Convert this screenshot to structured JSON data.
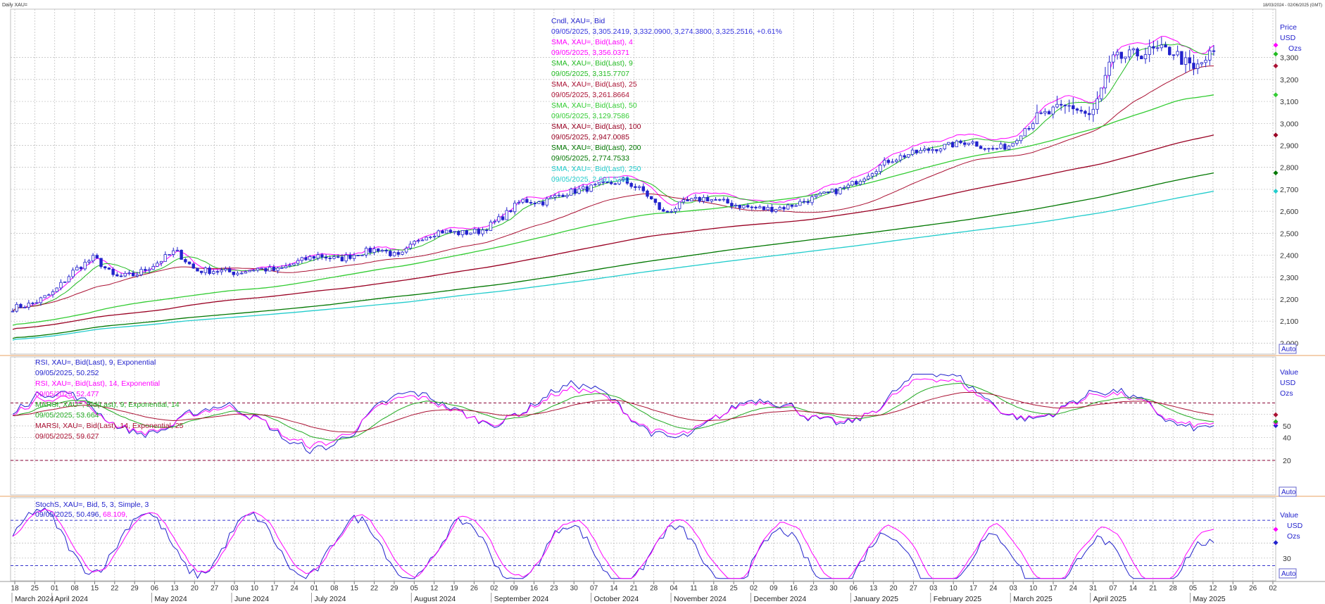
{
  "window": {
    "title": "Daily XAU=",
    "date_range": "18/03/2024 - 02/06/2025 (GMT)"
  },
  "price_panel": {
    "legend": [
      {
        "title": "Cndl, XAU=, Bid",
        "value": "09/05/2025, 3,305.2419, 3,332.0900, 3,274.3800, 3,325.2516, +0.61%",
        "color": "#2222cc",
        "value_color": "#3333dd"
      },
      {
        "title": "SMA, XAU=, Bid(Last),  4",
        "value": "09/05/2025, 3,356.0371",
        "color": "#ff00ff",
        "value_color": "#ff00ff"
      },
      {
        "title": "SMA, XAU=, Bid(Last),  9",
        "value": "09/05/2025, 3,315.7707",
        "color": "#22bb22",
        "value_color": "#22bb22"
      },
      {
        "title": "SMA, XAU=, Bid(Last),  25",
        "value": "09/05/2025, 3,261.8664",
        "color": "#aa1133",
        "value_color": "#aa1133"
      },
      {
        "title": "SMA, XAU=, Bid(Last),  50",
        "value": "09/05/2025, 3,129.7586",
        "color": "#33cc33",
        "value_color": "#33cc33"
      },
      {
        "title": "SMA, XAU=, Bid(Last),  100",
        "value": "09/05/2025, 2,947.0085",
        "color": "#990022",
        "value_color": "#990022"
      },
      {
        "title": "SMA, XAU=, Bid(Last),  200",
        "value": "09/05/2025, 2,774.7533",
        "color": "#007700",
        "value_color": "#007700"
      },
      {
        "title": "SMA, XAU=, Bid(Last),  250",
        "value": "09/05/2025, 2,691.5230",
        "color": "#22cccc",
        "value_color": "#22cccc"
      }
    ],
    "axis_header": [
      "Price",
      "USD",
      "Ozs"
    ],
    "auto_label": "Auto"
  },
  "rsi_panel": {
    "legend": [
      {
        "title": "RSI, XAU=, Bid(Last),  9, Exponential",
        "value": "09/05/2025, 50.252",
        "color": "#2222cc"
      },
      {
        "title": "RSI, XAU=, Bid(Last),  14, Exponential",
        "value": "09/05/2025, 52.477",
        "color": "#ff00ff"
      },
      {
        "title": "MARSI, XAU=, Bid(Last),  9, Exponential, 14",
        "value": "09/05/2025, 53.664",
        "color": "#22aa22"
      },
      {
        "title": "MARSI, XAU=, Bid(Last),  14, Exponential, 25",
        "value": "09/05/2025, 59.627",
        "color": "#aa1133"
      }
    ],
    "axis_header": [
      "Value",
      "USD",
      "Ozs"
    ],
    "auto_label": "Auto"
  },
  "stoch_panel": {
    "legend_title": "StochS, XAU=, Bid,  5, 3, Simple, 3",
    "legend_value_a": "09/05/2025, 50.496,",
    "legend_value_b": "68.109,",
    "axis_header": [
      "Value",
      "USD",
      "Ozs"
    ],
    "auto_label": "Auto"
  },
  "chart_data": [
    {
      "type": "candlestick",
      "instrument": "XAU=",
      "ylim": [
        1950,
        3520
      ],
      "yticks": [
        "2,000",
        "2,100",
        "2,200",
        "2,300",
        "2,400",
        "2,500",
        "2,600",
        "2,700",
        "2,800",
        "2,900",
        "3,000",
        "3,100",
        "3,200",
        "3,300"
      ],
      "ytick_values": [
        2000,
        2100,
        2200,
        2300,
        2400,
        2500,
        2600,
        2700,
        2800,
        2900,
        3000,
        3100,
        3200,
        3300
      ],
      "weekly_close_approx": [
        2160,
        2180,
        2230,
        2330,
        2390,
        2300,
        2310,
        2360,
        2420,
        2330,
        2330,
        2320,
        2340,
        2330,
        2370,
        2400,
        2380,
        2410,
        2430,
        2390,
        2480,
        2510,
        2500,
        2510,
        2570,
        2650,
        2640,
        2680,
        2700,
        2720,
        2740,
        2690,
        2590,
        2640,
        2660,
        2640,
        2620,
        2610,
        2620,
        2650,
        2680,
        2710,
        2770,
        2830,
        2860,
        2880,
        2900,
        2920,
        2880,
        2900,
        3010,
        3050,
        3080,
        3030,
        3290,
        3310,
        3330,
        3330,
        3240,
        3325
      ],
      "series": [
        {
          "name": "SMA 4",
          "last": 3356.0371,
          "color": "#ff00ff"
        },
        {
          "name": "SMA 9",
          "last": 3315.7707,
          "color": "#22bb22"
        },
        {
          "name": "SMA 25",
          "last": 3261.8664,
          "color": "#aa1133"
        },
        {
          "name": "SMA 50",
          "last": 3129.7586,
          "color": "#33cc33",
          "start": 2060
        },
        {
          "name": "SMA 100",
          "last": 2947.0085,
          "color": "#990022",
          "start": 2035
        },
        {
          "name": "SMA 200",
          "last": 2774.7533,
          "color": "#007700",
          "start": 1980
        },
        {
          "name": "SMA 250",
          "last": 2691.523,
          "color": "#22cccc",
          "start": 1970
        }
      ]
    },
    {
      "type": "line",
      "ylim": [
        -10,
        110
      ],
      "yticks": [
        "20",
        "40",
        "50"
      ],
      "ytick_values": [
        20,
        40,
        50
      ],
      "ref_lines": [
        20,
        70
      ],
      "series": [
        {
          "name": "RSI 9",
          "last": 50.252,
          "color": "#2222cc"
        },
        {
          "name": "RSI 14",
          "last": 52.477,
          "color": "#ff00ff"
        },
        {
          "name": "MARSI 9",
          "last": 53.664,
          "color": "#22aa22"
        },
        {
          "name": "MARSI 14",
          "last": 59.627,
          "color": "#aa1133"
        }
      ]
    },
    {
      "type": "line",
      "ylim": [
        0,
        110
      ],
      "yticks": [
        "30"
      ],
      "ytick_values": [
        30
      ],
      "ref_lines": [
        20,
        80
      ],
      "series": [
        {
          "name": "%K",
          "last": 50.496,
          "color": "#2222cc"
        },
        {
          "name": "%D",
          "last": 68.109,
          "color": "#ff00ff"
        }
      ]
    }
  ],
  "x_axis": {
    "day_ticks": [
      "18",
      "25",
      "01",
      "08",
      "15",
      "22",
      "29",
      "06",
      "13",
      "20",
      "27",
      "03",
      "10",
      "17",
      "24",
      "01",
      "08",
      "15",
      "22",
      "29",
      "05",
      "12",
      "19",
      "26",
      "02",
      "09",
      "16",
      "23",
      "30",
      "07",
      "14",
      "21",
      "28",
      "04",
      "11",
      "18",
      "25",
      "02",
      "09",
      "16",
      "23",
      "30",
      "06",
      "13",
      "20",
      "27",
      "03",
      "10",
      "17",
      "24",
      "03",
      "10",
      "17",
      "24",
      "31",
      "07",
      "14",
      "21",
      "28",
      "05",
      "12",
      "19",
      "26",
      "02"
    ],
    "months": [
      "March 2024",
      "April 2024",
      "May 2024",
      "June 2024",
      "July 2024",
      "August 2024",
      "September 2024",
      "October 2024",
      "November 2024",
      "December 2024",
      "January 2025",
      "February 2025",
      "March 2025",
      "April 2025",
      "May 2025"
    ]
  }
}
